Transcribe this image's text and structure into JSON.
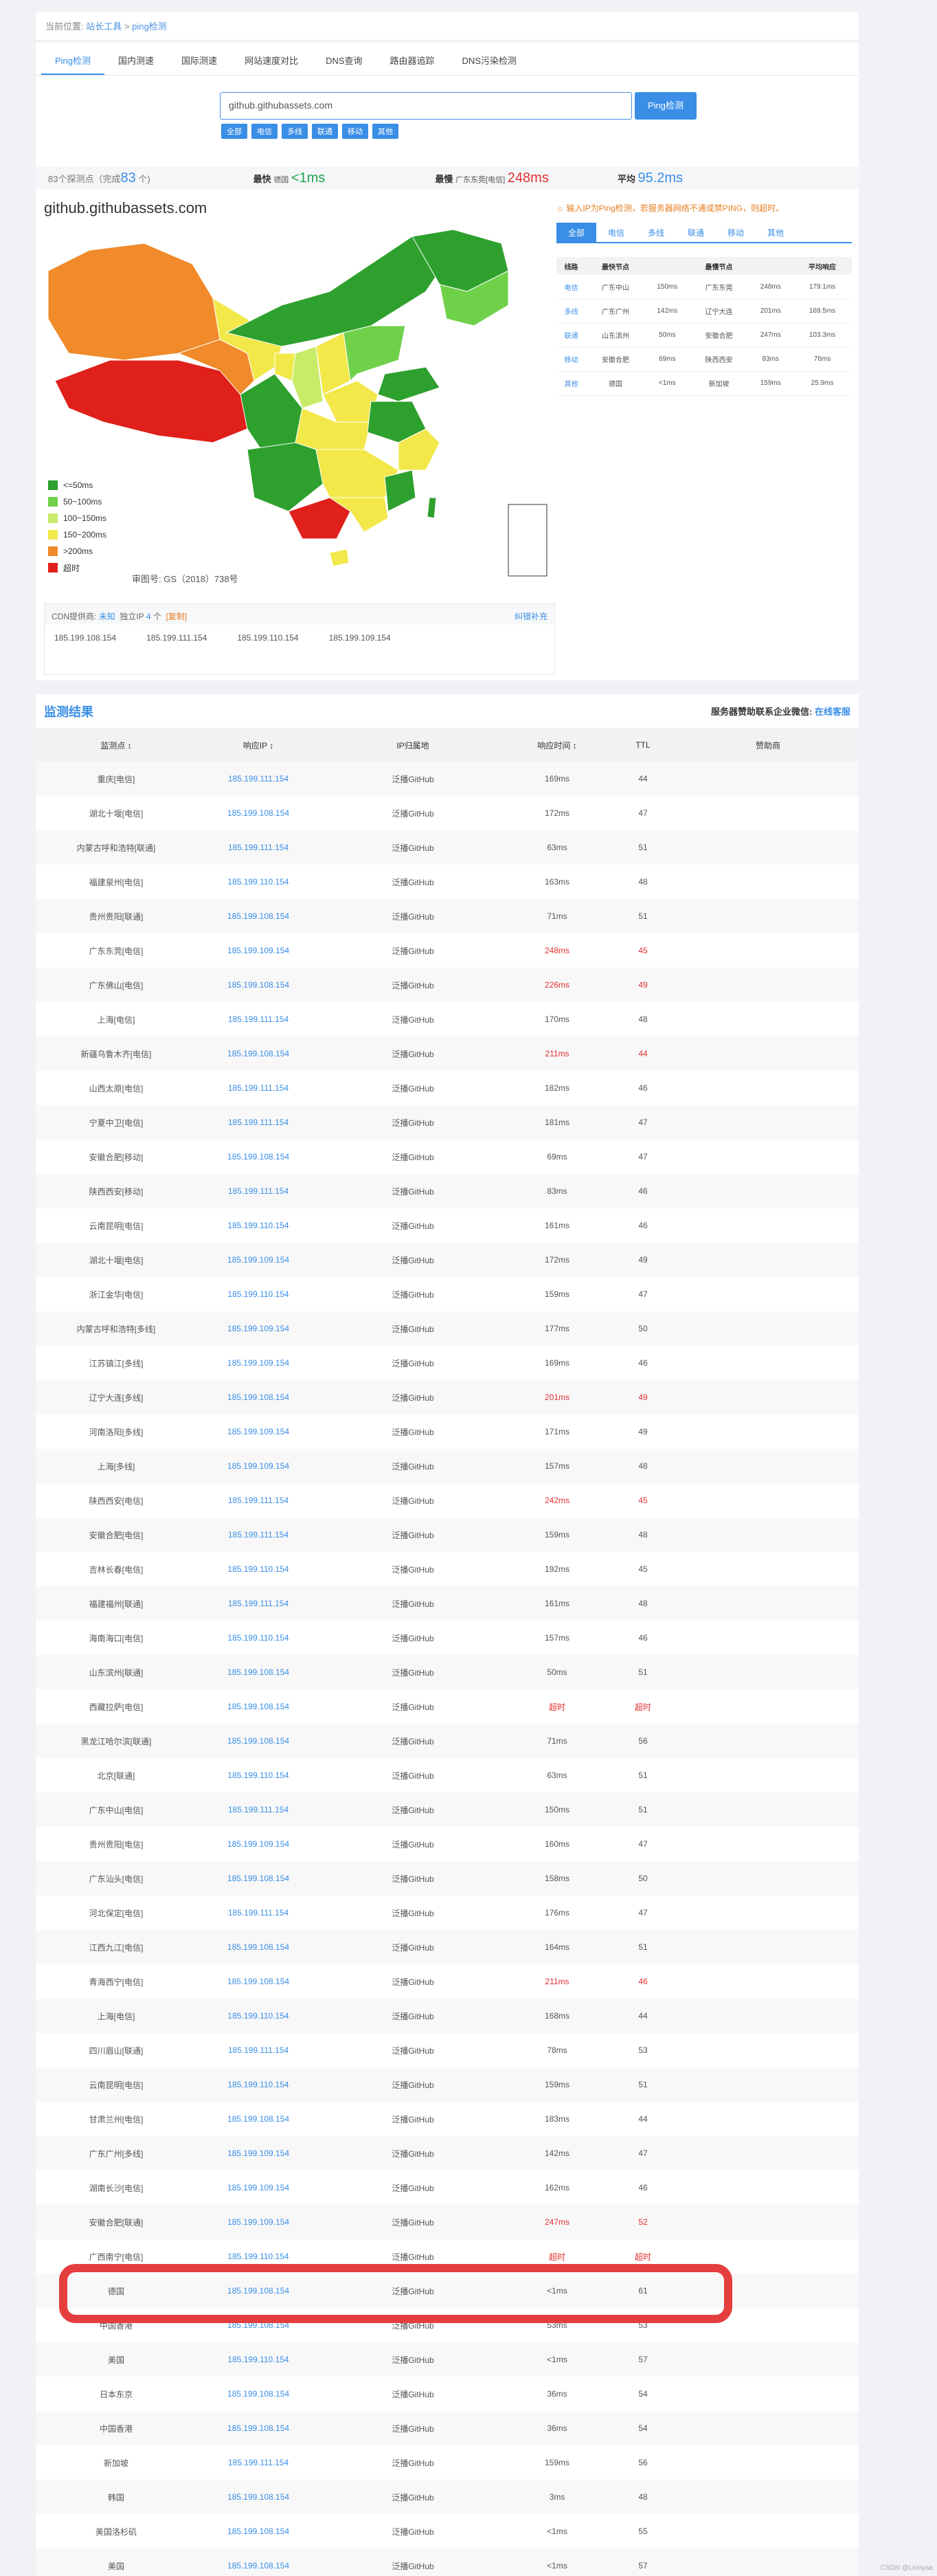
{
  "breadcrumb": {
    "prefix": "当前位置:",
    "site": "站长工具",
    "sep": " > ",
    "current": "ping检测"
  },
  "tabs": [
    "Ping检测",
    "国内测速",
    "国际测速",
    "网站速度对比",
    "DNS查询",
    "路由器追踪",
    "DNS污染检测"
  ],
  "search": {
    "value": "github.githubassets.com",
    "button": "Ping检测"
  },
  "chips": [
    "全部",
    "电信",
    "多线",
    "联通",
    "移动",
    "其他"
  ],
  "stats": {
    "count_pre": "83个探测点（完成",
    "count": "83",
    "count_suf": " 个)",
    "fast_label": "最快",
    "fast_loc": "德国",
    "fast_val": "<1ms",
    "slow_label": "最慢",
    "slow_loc": "广东东莞[电信]",
    "slow_val": "248ms",
    "avg_label": "平均",
    "avg_val": "95.2ms"
  },
  "map": {
    "title": "github.githubassets.com",
    "approval": "审图号: GS（2018）738号",
    "legend": [
      {
        "label": "<=50ms",
        "color": "#2ea02e"
      },
      {
        "label": "50~100ms",
        "color": "#6fd14a"
      },
      {
        "label": "100~150ms",
        "color": "#c8ec6a"
      },
      {
        "label": "150~200ms",
        "color": "#f2e84a"
      },
      {
        "label": ">200ms",
        "color": "#f08a2a"
      },
      {
        "label": "超时",
        "color": "#e0201a"
      }
    ]
  },
  "tip": "☼ 输入IP为Ping检测，若服务器网络不通或禁PING，则超时。",
  "right_tabs": [
    "全部",
    "电信",
    "多线",
    "联通",
    "移动",
    "其他"
  ],
  "mini_table": {
    "headers": [
      "线路",
      "最快节点",
      "",
      "最慢节点",
      "",
      "平均响应"
    ],
    "rows": [
      [
        "电信",
        "广东中山",
        "150ms",
        "广东东莞",
        "248ms",
        "179.1ms"
      ],
      [
        "多线",
        "广东广州",
        "142ms",
        "辽宁大连",
        "201ms",
        "169.5ms"
      ],
      [
        "联通",
        "山东滨州",
        "50ms",
        "安徽合肥",
        "247ms",
        "103.3ms"
      ],
      [
        "移动",
        "安徽合肥",
        "69ms",
        "陕西西安",
        "83ms",
        "76ms"
      ],
      [
        "其他",
        "德国",
        "<1ms",
        "新加坡",
        "159ms",
        "25.9ms"
      ]
    ]
  },
  "cdn": {
    "label": "CDN提供商:",
    "provider": "未知",
    "ip_label": "独立IP",
    "ip_count": "4",
    "ip_unit": "个",
    "copy": "[复制]",
    "link": "纠错补充",
    "ips": [
      "185.199.108.154",
      "185.199.111.154",
      "185.199.110.154",
      "185.199.109.154"
    ]
  },
  "results": {
    "title": "监测结果",
    "right": "服务器赞助联系企业微信:",
    "right_link": "在线客服",
    "headers": [
      "监测点 ↕",
      "响应IP ↕",
      "IP归属地",
      "响应时间 ↕",
      "TTL",
      "赞助商"
    ],
    "rows": [
      [
        "重庆[电信]",
        "185.199.111.154",
        "泛播GitHub",
        "169ms",
        "44"
      ],
      [
        "湖北十堰[电信]",
        "185.199.108.154",
        "泛播GitHub",
        "172ms",
        "47"
      ],
      [
        "内蒙古呼和浩特[联通]",
        "185.199.111.154",
        "泛播GitHub",
        "63ms",
        "51"
      ],
      [
        "福建泉州[电信]",
        "185.199.110.154",
        "泛播GitHub",
        "163ms",
        "48"
      ],
      [
        "贵州贵阳[联通]",
        "185.199.108.154",
        "泛播GitHub",
        "71ms",
        "51"
      ],
      [
        "广东东莞[电信]",
        "185.199.109.154",
        "泛播GitHub",
        "248ms",
        "45"
      ],
      [
        "广东佛山[电信]",
        "185.199.108.154",
        "泛播GitHub",
        "226ms",
        "49"
      ],
      [
        "上海[电信]",
        "185.199.111.154",
        "泛播GitHub",
        "170ms",
        "48"
      ],
      [
        "新疆乌鲁木齐[电信]",
        "185.199.108.154",
        "泛播GitHub",
        "211ms",
        "44"
      ],
      [
        "山西太原[电信]",
        "185.199.111.154",
        "泛播GitHub",
        "182ms",
        "46"
      ],
      [
        "宁夏中卫[电信]",
        "185.199.111.154",
        "泛播GitHub",
        "181ms",
        "47"
      ],
      [
        "安徽合肥[移动]",
        "185.199.108.154",
        "泛播GitHub",
        "69ms",
        "47"
      ],
      [
        "陕西西安[移动]",
        "185.199.111.154",
        "泛播GitHub",
        "83ms",
        "46"
      ],
      [
        "云南昆明[电信]",
        "185.199.110.154",
        "泛播GitHub",
        "161ms",
        "46"
      ],
      [
        "湖北十堰[电信]",
        "185.199.109.154",
        "泛播GitHub",
        "172ms",
        "49"
      ],
      [
        "浙江金华[电信]",
        "185.199.110.154",
        "泛播GitHub",
        "159ms",
        "47"
      ],
      [
        "内蒙古呼和浩特[多线]",
        "185.199.109.154",
        "泛播GitHub",
        "177ms",
        "50"
      ],
      [
        "江苏镇江[多线]",
        "185.199.109.154",
        "泛播GitHub",
        "169ms",
        "46"
      ],
      [
        "辽宁大连[多线]",
        "185.199.108.154",
        "泛播GitHub",
        "201ms",
        "49"
      ],
      [
        "河南洛阳[多线]",
        "185.199.109.154",
        "泛播GitHub",
        "171ms",
        "49"
      ],
      [
        "上海[多线]",
        "185.199.109.154",
        "泛播GitHub",
        "157ms",
        "48"
      ],
      [
        "陕西西安[电信]",
        "185.199.111.154",
        "泛播GitHub",
        "242ms",
        "45"
      ],
      [
        "安徽合肥[电信]",
        "185.199.111.154",
        "泛播GitHub",
        "159ms",
        "48"
      ],
      [
        "吉林长春[电信]",
        "185.199.110.154",
        "泛播GitHub",
        "192ms",
        "45"
      ],
      [
        "福建福州[联通]",
        "185.199.111.154",
        "泛播GitHub",
        "161ms",
        "48"
      ],
      [
        "海南海口[电信]",
        "185.199.110.154",
        "泛播GitHub",
        "157ms",
        "46"
      ],
      [
        "山东滨州[联通]",
        "185.199.108.154",
        "泛播GitHub",
        "50ms",
        "51"
      ],
      [
        "西藏拉萨[电信]",
        "185.199.108.154",
        "泛播GitHub",
        "超时",
        "超时"
      ],
      [
        "黑龙江哈尔滨[联通]",
        "185.199.108.154",
        "泛播GitHub",
        "71ms",
        "56"
      ],
      [
        "北京[联通]",
        "185.199.110.154",
        "泛播GitHub",
        "63ms",
        "51"
      ],
      [
        "广东中山[电信]",
        "185.199.111.154",
        "泛播GitHub",
        "150ms",
        "51"
      ],
      [
        "贵州贵阳[电信]",
        "185.199.109.154",
        "泛播GitHub",
        "160ms",
        "47"
      ],
      [
        "广东汕头[电信]",
        "185.199.108.154",
        "泛播GitHub",
        "158ms",
        "50"
      ],
      [
        "河北保定[电信]",
        "185.199.111.154",
        "泛播GitHub",
        "176ms",
        "47"
      ],
      [
        "江西九江[电信]",
        "185.199.108.154",
        "泛播GitHub",
        "164ms",
        "51"
      ],
      [
        "青海西宁[电信]",
        "185.199.108.154",
        "泛播GitHub",
        "211ms",
        "46"
      ],
      [
        "上海[电信]",
        "185.199.110.154",
        "泛播GitHub",
        "168ms",
        "44"
      ],
      [
        "四川眉山[联通]",
        "185.199.111.154",
        "泛播GitHub",
        "78ms",
        "53"
      ],
      [
        "云南昆明[电信]",
        "185.199.110.154",
        "泛播GitHub",
        "159ms",
        "51"
      ],
      [
        "甘肃兰州[电信]",
        "185.199.108.154",
        "泛播GitHub",
        "183ms",
        "44"
      ],
      [
        "广东广州[多线]",
        "185.199.109.154",
        "泛播GitHub",
        "142ms",
        "47"
      ],
      [
        "湖南长沙[电信]",
        "185.199.109.154",
        "泛播GitHub",
        "162ms",
        "46"
      ],
      [
        "安徽合肥[联通]",
        "185.199.109.154",
        "泛播GitHub",
        "247ms",
        "52"
      ],
      [
        "广西南宁[电信]",
        "185.199.110.154",
        "泛播GitHub",
        "超时",
        "超时"
      ],
      [
        "德国",
        "185.199.108.154",
        "泛播GitHub",
        "<1ms",
        "61"
      ],
      [
        "中国香港",
        "185.199.108.154",
        "泛播GitHub",
        "53ms",
        "53"
      ],
      [
        "美国",
        "185.199.110.154",
        "泛播GitHub",
        "<1ms",
        "57"
      ],
      [
        "日本东京",
        "185.199.108.154",
        "泛播GitHub",
        "36ms",
        "54"
      ],
      [
        "中国香港",
        "185.199.108.154",
        "泛播GitHub",
        "36ms",
        "54"
      ],
      [
        "新加坡",
        "185.199.111.154",
        "泛播GitHub",
        "159ms",
        "56"
      ],
      [
        "韩国",
        "185.199.108.154",
        "泛播GitHub",
        "3ms",
        "48"
      ],
      [
        "美国洛杉矶",
        "185.199.108.154",
        "泛播GitHub",
        "<1ms",
        "55"
      ],
      [
        "美国",
        "185.199.108.154",
        "泛播GitHub",
        "<1ms",
        "57"
      ]
    ]
  },
  "watermark": "CSDN @Lionyaa"
}
